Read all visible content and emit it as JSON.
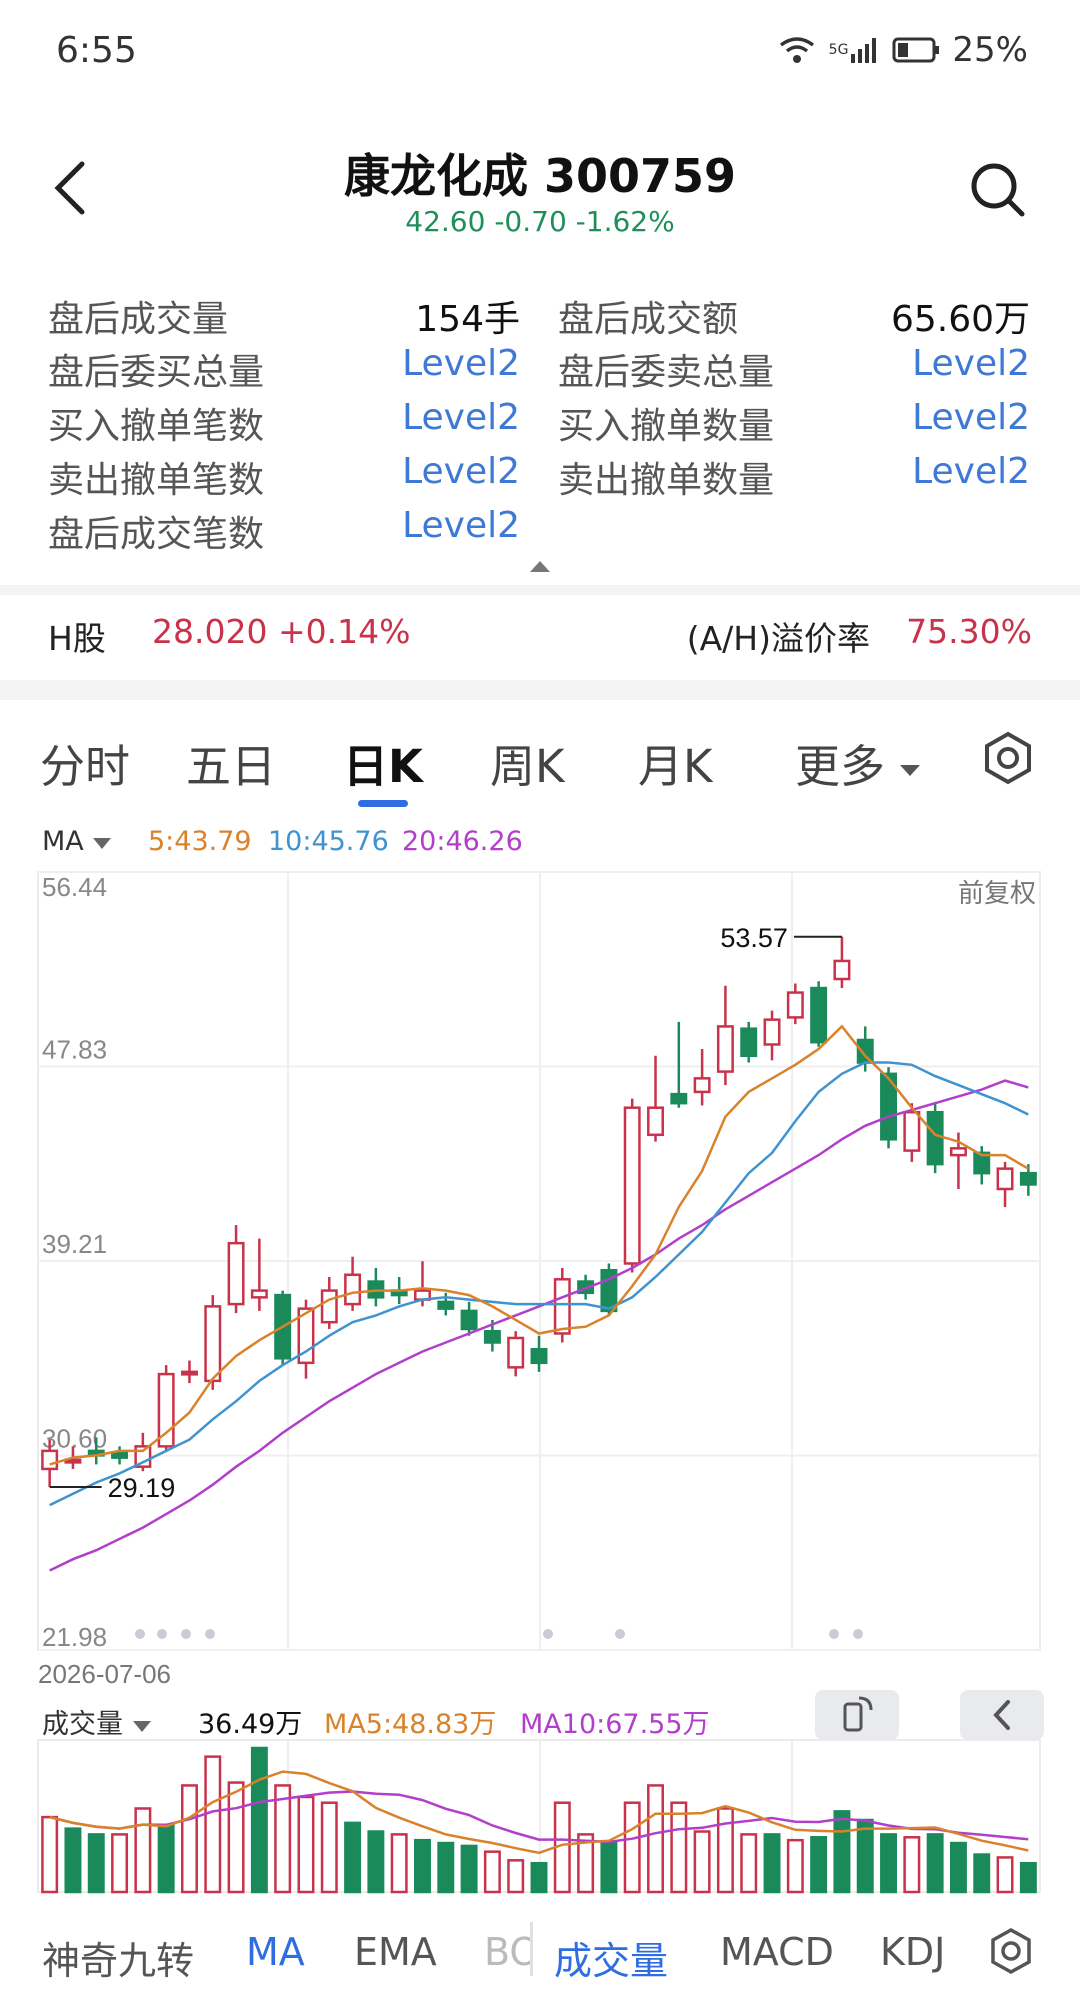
{
  "status_bar": {
    "time": "6:55",
    "network": "5G",
    "battery": "25%"
  },
  "header": {
    "title": "康龙化成 300759",
    "quote": "42.60 -0.70 -1.62%"
  },
  "after_hours": [
    {
      "label": "盘后成交量",
      "value": "154手",
      "type": "plain"
    },
    {
      "label": "盘后成交额",
      "value": "65.60万",
      "type": "plain"
    },
    {
      "label": "盘后委买总量",
      "value": "Level2",
      "type": "link"
    },
    {
      "label": "盘后委卖总量",
      "value": "Level2",
      "type": "link"
    },
    {
      "label": "买入撤单笔数",
      "value": "Level2",
      "type": "link"
    },
    {
      "label": "买入撤单数量",
      "value": "Level2",
      "type": "link"
    },
    {
      "label": "卖出撤单笔数",
      "value": "Level2",
      "type": "link"
    },
    {
      "label": "卖出撤单数量",
      "value": "Level2",
      "type": "link"
    },
    {
      "label": "盘后成交笔数",
      "value": "Level2",
      "type": "link"
    }
  ],
  "hk": {
    "label": "H股",
    "value": "28.020 +0.14%",
    "ah_label": "(A/H)溢价率",
    "ah_value": "75.30%"
  },
  "tabs": [
    "分时",
    "五日",
    "日K",
    "周K",
    "月K",
    "更多"
  ],
  "active_tab": "日K",
  "ma_legend": {
    "selector": "MA",
    "ma5": "5:43.79",
    "ma10": "10:45.76",
    "ma20": "20:46.26"
  },
  "price_axis": [
    "56.44",
    "47.83",
    "39.21",
    "30.60",
    "21.98"
  ],
  "adjust_label": "前复权",
  "high_label": "53.57",
  "low_label": "29.19",
  "start_date": "2026-07-06",
  "volume_legend": {
    "selector": "成交量",
    "value": "36.49万",
    "ma5": "MA5:48.83万",
    "ma10": "MA10:67.55万"
  },
  "bottom_tabs": [
    "神奇九转",
    "MA",
    "EMA",
    "BOLL",
    "成交量",
    "MACD",
    "KDJ"
  ],
  "colors": {
    "up": "#c8324a",
    "down": "#1b8a5a",
    "ma5": "#d9822b",
    "ma10": "#3f93cf",
    "ma20": "#b23fc9",
    "link": "#3f79d6"
  },
  "chart_data": {
    "type": "candlestick",
    "ylim": [
      21.98,
      56.44
    ],
    "candles": [
      {
        "o": 30.0,
        "c": 30.8,
        "h": 31.3,
        "l": 29.2
      },
      {
        "o": 30.4,
        "c": 30.4,
        "h": 31.0,
        "l": 30.0
      },
      {
        "o": 30.8,
        "c": 30.6,
        "h": 31.4,
        "l": 30.2
      },
      {
        "o": 30.7,
        "c": 30.5,
        "h": 31.0,
        "l": 30.2
      },
      {
        "o": 30.1,
        "c": 31.0,
        "h": 31.6,
        "l": 29.9
      },
      {
        "o": 31.0,
        "c": 34.2,
        "h": 34.6,
        "l": 30.8
      },
      {
        "o": 34.3,
        "c": 34.3,
        "h": 34.8,
        "l": 33.8
      },
      {
        "o": 33.9,
        "c": 37.2,
        "h": 37.7,
        "l": 33.5
      },
      {
        "o": 37.3,
        "c": 40.0,
        "h": 40.8,
        "l": 36.9
      },
      {
        "o": 37.6,
        "c": 37.9,
        "h": 40.2,
        "l": 37.0
      },
      {
        "o": 37.7,
        "c": 34.9,
        "h": 37.9,
        "l": 34.6
      },
      {
        "o": 34.7,
        "c": 37.1,
        "h": 37.5,
        "l": 34.0
      },
      {
        "o": 36.5,
        "c": 37.9,
        "h": 38.5,
        "l": 36.2
      },
      {
        "o": 37.3,
        "c": 38.6,
        "h": 39.4,
        "l": 37.0
      },
      {
        "o": 38.3,
        "c": 37.6,
        "h": 38.9,
        "l": 37.2
      },
      {
        "o": 37.9,
        "c": 37.7,
        "h": 38.5,
        "l": 37.3
      },
      {
        "o": 37.5,
        "c": 37.9,
        "h": 39.2,
        "l": 37.2
      },
      {
        "o": 37.4,
        "c": 37.1,
        "h": 37.8,
        "l": 36.8
      },
      {
        "o": 37.0,
        "c": 36.2,
        "h": 37.4,
        "l": 35.9
      },
      {
        "o": 36.1,
        "c": 35.6,
        "h": 36.6,
        "l": 35.2
      },
      {
        "o": 34.5,
        "c": 35.8,
        "h": 36.1,
        "l": 34.1
      },
      {
        "o": 35.3,
        "c": 34.7,
        "h": 35.9,
        "l": 34.3
      },
      {
        "o": 36.0,
        "c": 38.4,
        "h": 38.9,
        "l": 35.6
      },
      {
        "o": 38.3,
        "c": 37.8,
        "h": 38.6,
        "l": 37.5
      },
      {
        "o": 38.8,
        "c": 37.0,
        "h": 39.1,
        "l": 36.8
      },
      {
        "o": 39.1,
        "c": 46.0,
        "h": 46.4,
        "l": 38.7
      },
      {
        "o": 44.8,
        "c": 46.0,
        "h": 48.3,
        "l": 44.5
      },
      {
        "o": 46.6,
        "c": 46.2,
        "h": 49.8,
        "l": 46.0
      },
      {
        "o": 46.7,
        "c": 47.3,
        "h": 48.6,
        "l": 46.1
      },
      {
        "o": 47.6,
        "c": 49.6,
        "h": 51.4,
        "l": 47.0
      },
      {
        "o": 49.5,
        "c": 48.3,
        "h": 49.8,
        "l": 48.0
      },
      {
        "o": 48.8,
        "c": 49.9,
        "h": 50.3,
        "l": 48.1
      },
      {
        "o": 50.0,
        "c": 51.1,
        "h": 51.5,
        "l": 49.7
      },
      {
        "o": 51.3,
        "c": 48.9,
        "h": 51.6,
        "l": 48.7
      },
      {
        "o": 51.7,
        "c": 52.5,
        "h": 53.57,
        "l": 51.3
      },
      {
        "o": 49.0,
        "c": 48.0,
        "h": 49.6,
        "l": 47.6
      },
      {
        "o": 47.5,
        "c": 44.6,
        "h": 47.8,
        "l": 44.2
      },
      {
        "o": 44.1,
        "c": 45.8,
        "h": 46.2,
        "l": 43.6
      },
      {
        "o": 45.8,
        "c": 43.5,
        "h": 46.2,
        "l": 43.1
      },
      {
        "o": 43.9,
        "c": 44.2,
        "h": 44.9,
        "l": 42.4
      },
      {
        "o": 44.0,
        "c": 43.1,
        "h": 44.3,
        "l": 42.6
      },
      {
        "o": 42.4,
        "c": 43.3,
        "h": 43.6,
        "l": 41.6
      },
      {
        "o": 43.1,
        "c": 42.6,
        "h": 43.5,
        "l": 42.1
      }
    ],
    "ma5": [
      30.2,
      30.5,
      30.6,
      30.8,
      30.8,
      31.6,
      32.5,
      34.0,
      35.0,
      35.7,
      36.3,
      36.9,
      37.5,
      37.8,
      37.9,
      37.9,
      38.0,
      37.9,
      37.7,
      37.2,
      36.6,
      36.0,
      36.2,
      36.3,
      36.8,
      38.1,
      39.5,
      41.6,
      43.2,
      45.6,
      46.7,
      47.3,
      47.9,
      48.6,
      49.6,
      48.3,
      47.3,
      46.0,
      44.8,
      44.5,
      43.9,
      43.9,
      43.3
    ],
    "ma10": [
      28.4,
      28.9,
      29.4,
      29.8,
      30.3,
      30.8,
      31.3,
      32.2,
      33.0,
      33.9,
      34.6,
      35.2,
      35.9,
      36.5,
      36.8,
      37.2,
      37.5,
      37.6,
      37.5,
      37.4,
      37.3,
      37.3,
      37.3,
      37.3,
      37.1,
      37.6,
      38.5,
      39.5,
      40.5,
      41.8,
      43.1,
      44.0,
      45.4,
      46.7,
      47.5,
      48.0,
      48.0,
      47.9,
      47.4,
      47.0,
      46.6,
      46.2,
      45.7
    ],
    "ma20": [
      25.5,
      26.0,
      26.4,
      26.9,
      27.4,
      28.0,
      28.6,
      29.3,
      30.1,
      30.8,
      31.6,
      32.3,
      33.0,
      33.6,
      34.2,
      34.7,
      35.2,
      35.6,
      36.0,
      36.4,
      36.8,
      37.2,
      37.6,
      38.0,
      38.4,
      38.9,
      39.5,
      40.2,
      40.8,
      41.5,
      42.1,
      42.7,
      43.3,
      43.9,
      44.6,
      45.2,
      45.6,
      45.9,
      46.2,
      46.5,
      46.8,
      47.2,
      46.9
    ],
    "volume": [
      {
        "v": 52,
        "up": true
      },
      {
        "v": 44,
        "up": false
      },
      {
        "v": 40,
        "up": false
      },
      {
        "v": 40,
        "up": true
      },
      {
        "v": 58,
        "up": true
      },
      {
        "v": 46,
        "up": false
      },
      {
        "v": 74,
        "up": true
      },
      {
        "v": 94,
        "up": true
      },
      {
        "v": 76,
        "up": true
      },
      {
        "v": 100,
        "up": false
      },
      {
        "v": 74,
        "up": true
      },
      {
        "v": 66,
        "up": true
      },
      {
        "v": 62,
        "up": true
      },
      {
        "v": 48,
        "up": false
      },
      {
        "v": 42,
        "up": false
      },
      {
        "v": 40,
        "up": true
      },
      {
        "v": 36,
        "up": false
      },
      {
        "v": 34,
        "up": false
      },
      {
        "v": 32,
        "up": false
      },
      {
        "v": 28,
        "up": true
      },
      {
        "v": 22,
        "up": true
      },
      {
        "v": 20,
        "up": false
      },
      {
        "v": 62,
        "up": true
      },
      {
        "v": 40,
        "up": true
      },
      {
        "v": 34,
        "up": false
      },
      {
        "v": 62,
        "up": true
      },
      {
        "v": 74,
        "up": true
      },
      {
        "v": 62,
        "up": true
      },
      {
        "v": 42,
        "up": true
      },
      {
        "v": 58,
        "up": true
      },
      {
        "v": 40,
        "up": true
      },
      {
        "v": 40,
        "up": false
      },
      {
        "v": 36,
        "up": true
      },
      {
        "v": 38,
        "up": false
      },
      {
        "v": 56,
        "up": false
      },
      {
        "v": 50,
        "up": false
      },
      {
        "v": 40,
        "up": false
      },
      {
        "v": 38,
        "up": true
      },
      {
        "v": 40,
        "up": false
      },
      {
        "v": 34,
        "up": false
      },
      {
        "v": 26,
        "up": false
      },
      {
        "v": 24,
        "up": true
      },
      {
        "v": 20,
        "up": false
      }
    ]
  }
}
